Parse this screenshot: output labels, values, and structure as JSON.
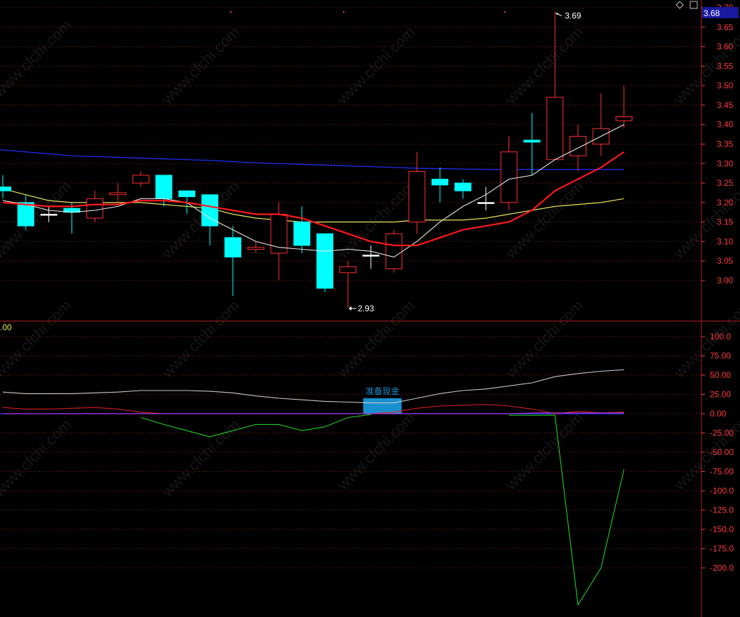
{
  "chart_data": [
    {
      "type": "candlestick",
      "panel": "price",
      "y_ticks": [
        "3.70",
        "3.65",
        "3.60",
        "3.55",
        "3.50",
        "3.45",
        "3.40",
        "3.35",
        "3.30",
        "3.25",
        "3.20",
        "3.15",
        "3.10",
        "3.05",
        "3.00"
      ],
      "ylim": [
        2.905,
        3.7
      ],
      "current_price_label": "3.68",
      "high_annotation": "3.69",
      "low_annotation": "2.93",
      "candles": [
        {
          "o": 3.24,
          "h": 3.27,
          "l": 3.21,
          "c": 3.23
        },
        {
          "o": 3.2,
          "h": 3.22,
          "l": 3.13,
          "c": 3.14
        },
        {
          "o": 3.17,
          "h": 3.19,
          "l": 3.15,
          "c": 3.17
        },
        {
          "o": 3.185,
          "h": 3.2,
          "l": 3.12,
          "c": 3.175
        },
        {
          "o": 3.16,
          "h": 3.23,
          "l": 3.15,
          "c": 3.21
        },
        {
          "o": 3.22,
          "h": 3.25,
          "l": 3.2,
          "c": 3.225
        },
        {
          "o": 3.25,
          "h": 3.28,
          "l": 3.24,
          "c": 3.27
        },
        {
          "o": 3.27,
          "h": 3.27,
          "l": 3.19,
          "c": 3.21
        },
        {
          "o": 3.23,
          "h": 3.23,
          "l": 3.17,
          "c": 3.215
        },
        {
          "o": 3.22,
          "h": 3.22,
          "l": 3.09,
          "c": 3.14
        },
        {
          "o": 3.11,
          "h": 3.14,
          "l": 2.96,
          "c": 3.06
        },
        {
          "o": 3.08,
          "h": 3.1,
          "l": 3.07,
          "c": 3.085
        },
        {
          "o": 3.07,
          "h": 3.2,
          "l": 3.0,
          "c": 3.17
        },
        {
          "o": 3.15,
          "h": 3.19,
          "l": 3.07,
          "c": 3.09
        },
        {
          "o": 3.12,
          "h": 3.12,
          "l": 2.97,
          "c": 2.98
        },
        {
          "o": 3.02,
          "h": 3.05,
          "l": 2.93,
          "c": 3.035
        },
        {
          "o": 3.065,
          "h": 3.09,
          "l": 3.03,
          "c": 3.065
        },
        {
          "o": 3.03,
          "h": 3.13,
          "l": 3.02,
          "c": 3.12
        },
        {
          "o": 3.15,
          "h": 3.33,
          "l": 3.12,
          "c": 3.28
        },
        {
          "o": 3.26,
          "h": 3.29,
          "l": 3.2,
          "c": 3.245
        },
        {
          "o": 3.25,
          "h": 3.26,
          "l": 3.21,
          "c": 3.23
        },
        {
          "o": 3.2,
          "h": 3.24,
          "l": 3.18,
          "c": 3.2
        },
        {
          "o": 3.2,
          "h": 3.37,
          "l": 3.18,
          "c": 3.33
        },
        {
          "o": 3.36,
          "h": 3.43,
          "l": 3.27,
          "c": 3.355
        },
        {
          "o": 3.31,
          "h": 3.69,
          "l": 3.31,
          "c": 3.47
        },
        {
          "o": 3.32,
          "h": 3.4,
          "l": 3.28,
          "c": 3.37
        },
        {
          "o": 3.35,
          "h": 3.48,
          "l": 3.32,
          "c": 3.39
        },
        {
          "o": 3.41,
          "h": 3.5,
          "l": 3.39,
          "c": 3.42
        }
      ],
      "ma_white": [
        3.205,
        3.195,
        3.18,
        3.175,
        3.18,
        3.19,
        3.21,
        3.21,
        3.2,
        3.16,
        3.13,
        3.1,
        3.085,
        3.08,
        3.075,
        3.08,
        3.075,
        3.06,
        3.1,
        3.15,
        3.19,
        3.22,
        3.26,
        3.27,
        3.31,
        3.34,
        3.37,
        3.4
      ],
      "ma_yellow": [
        3.235,
        3.22,
        3.205,
        3.2,
        3.2,
        3.2,
        3.2,
        3.195,
        3.19,
        3.185,
        3.17,
        3.16,
        3.155,
        3.15,
        3.15,
        3.15,
        3.15,
        3.15,
        3.155,
        3.155,
        3.155,
        3.16,
        3.17,
        3.18,
        3.19,
        3.195,
        3.2,
        3.21
      ],
      "ma_red": [
        3.2,
        3.195,
        3.19,
        3.19,
        3.195,
        3.195,
        3.205,
        3.205,
        3.2,
        3.19,
        3.18,
        3.17,
        3.17,
        3.16,
        3.14,
        3.12,
        3.1,
        3.09,
        3.09,
        3.11,
        3.13,
        3.14,
        3.15,
        3.18,
        3.23,
        3.26,
        3.29,
        3.33
      ],
      "ma_blue": [
        3.335,
        3.33,
        3.325,
        3.32,
        3.318,
        3.316,
        3.314,
        3.312,
        3.31,
        3.308,
        3.305,
        3.302,
        3.3,
        3.298,
        3.296,
        3.294,
        3.292,
        3.29,
        3.288,
        3.287,
        3.286,
        3.285,
        3.285,
        3.285,
        3.285,
        3.285,
        3.285,
        3.285
      ]
    },
    {
      "type": "line",
      "panel": "indicator",
      "y_ticks": [
        "100.0",
        "75.00",
        "50.00",
        "25.00",
        "0.00",
        "-25.00",
        "-50.00",
        "-75.00",
        "-100.0",
        "-125.0",
        "-150.0",
        "-175.0",
        "-200.0"
      ],
      "ylim": [
        -252,
        115
      ],
      "left_value_label": ".00",
      "signal_label": "准备现金",
      "signal_bar": {
        "x_start": 16,
        "x_end": 17,
        "value": 20
      },
      "series": [
        {
          "color": "#c8c8c8",
          "values": [
            28,
            26,
            26,
            26,
            27,
            28,
            30,
            30,
            30,
            29,
            27,
            23,
            20,
            18,
            16,
            15,
            14,
            14,
            20,
            26,
            30,
            32,
            36,
            40,
            48,
            52,
            55,
            57
          ]
        },
        {
          "color": "#d02020",
          "values": [
            8,
            6,
            6,
            7,
            8,
            6,
            2,
            0,
            0,
            0,
            0,
            0,
            0,
            0,
            0,
            0,
            0,
            2,
            7,
            10,
            11,
            12,
            10,
            6,
            0,
            3,
            1,
            2
          ]
        },
        {
          "color": "#cc33cc",
          "values": [
            0,
            0,
            0,
            0,
            0,
            0,
            0,
            0,
            0,
            0,
            0,
            0,
            0,
            0,
            0,
            0,
            0,
            0,
            0,
            0,
            0,
            0,
            0,
            1,
            1,
            1,
            1,
            1
          ]
        },
        {
          "color": "#20d020",
          "values": [
            null,
            null,
            null,
            null,
            null,
            null,
            -5,
            -14,
            -22,
            -30,
            -22,
            -14,
            -14,
            -22,
            -17,
            -5,
            -1,
            null,
            null,
            null,
            null,
            null,
            -2,
            -2,
            -2,
            -248,
            -200,
            -72
          ]
        }
      ]
    }
  ],
  "colors": {
    "up": "#ff3030",
    "down": "#00ffff",
    "doji": "#ffffff",
    "grid": "#8a1f1f",
    "axis_text": "#ff3b3b",
    "ma_white": "#e8e8e8",
    "ma_yellow": "#e6e65a",
    "ma_red": "#ff1a1a",
    "ma_blue": "#2030ff",
    "price_box": "#1a1aa0",
    "signal": "#1890d0"
  },
  "watermark": "www.cfchi.com"
}
